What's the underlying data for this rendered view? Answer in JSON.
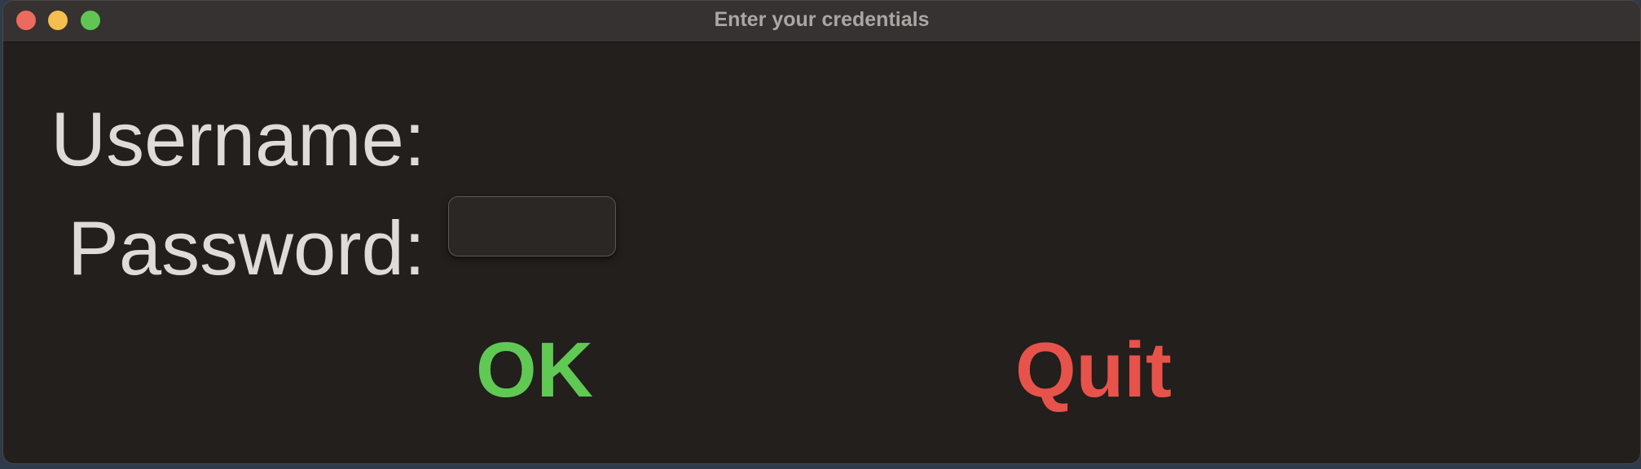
{
  "window": {
    "title": "Enter your credentials"
  },
  "form": {
    "username_label": "Username:",
    "password_label": "Password:",
    "password_value": ""
  },
  "buttons": {
    "ok_label": "OK",
    "quit_label": "Quit"
  },
  "colors": {
    "ok": "#60c954",
    "quit": "#e7534a",
    "window_bg": "#221f1d",
    "titlebar_bg": "#353231"
  }
}
